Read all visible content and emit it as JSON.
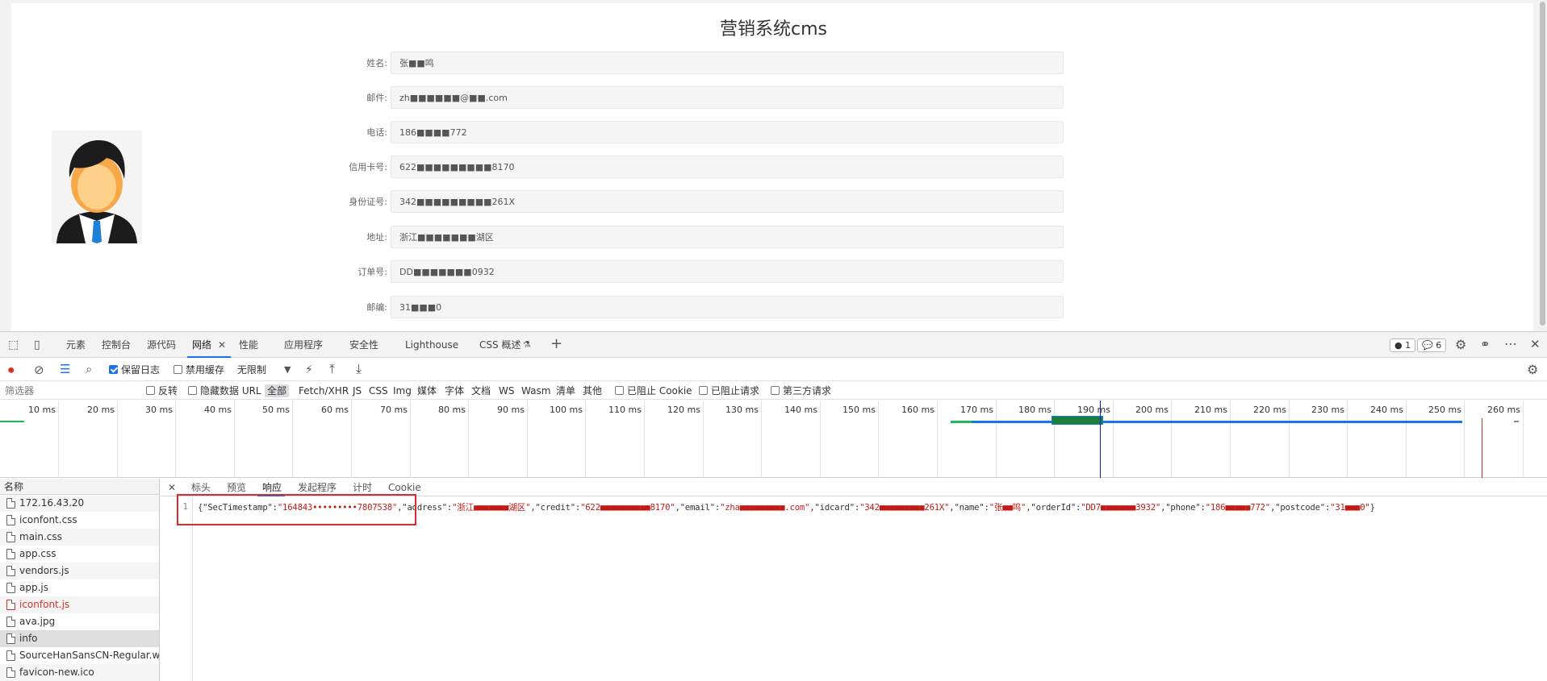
{
  "page": {
    "title": "营销系统cms",
    "fields": [
      {
        "label": "姓名:",
        "value": "张■■鸣"
      },
      {
        "label": "邮件:",
        "value": "zh■■■■■■@■■.com"
      },
      {
        "label": "电话:",
        "value": "186■■■■772"
      },
      {
        "label": "信用卡号:",
        "value": "622■■■■■■■■■8170"
      },
      {
        "label": "身份证号:",
        "value": "342■■■■■■■■■261X"
      },
      {
        "label": "地址:",
        "value": "浙江■■■■■■■湖区"
      },
      {
        "label": "订单号:",
        "value": "DD■■■■■■■0932"
      },
      {
        "label": "邮编:",
        "value": "31■■■0"
      }
    ]
  },
  "devtools": {
    "tabs": [
      "元素",
      "控制台",
      "源代码",
      "网络",
      "性能",
      "应用程序",
      "安全性",
      "Lighthouse",
      "CSS 概述"
    ],
    "issues_count": "1",
    "messages_count": "6",
    "toolbar": {
      "preserve_log": "保留日志",
      "disable_cache": "禁用缓存",
      "throttle": "无限制"
    },
    "filter": {
      "placeholder": "筛选器",
      "invert": "反转",
      "hide_data_urls": "隐藏数据 URL",
      "types": [
        "全部",
        "Fetch/XHR",
        "JS",
        "CSS",
        "Img",
        "媒体",
        "字体",
        "文档",
        "WS",
        "Wasm",
        "清单",
        "其他"
      ],
      "blocked_cookies": "已阻止 Cookie",
      "blocked_requests": "已阻止请求",
      "third_party": "第三方请求"
    },
    "timeline_ticks": [
      "10 ms",
      "20 ms",
      "30 ms",
      "40 ms",
      "50 ms",
      "60 ms",
      "70 ms",
      "80 ms",
      "90 ms",
      "100 ms",
      "110 ms",
      "120 ms",
      "130 ms",
      "140 ms",
      "150 ms",
      "160 ms",
      "170 ms",
      "180 ms",
      "190 ms",
      "200 ms",
      "210 ms",
      "220 ms",
      "230 ms",
      "240 ms",
      "250 ms",
      "260 ms"
    ],
    "list_header": "名称",
    "requests": [
      {
        "name": "172.16.43.20",
        "error": false,
        "selected": false
      },
      {
        "name": "iconfont.css",
        "error": false,
        "selected": false
      },
      {
        "name": "main.css",
        "error": false,
        "selected": false
      },
      {
        "name": "app.css",
        "error": false,
        "selected": false
      },
      {
        "name": "vendors.js",
        "error": false,
        "selected": false
      },
      {
        "name": "app.js",
        "error": false,
        "selected": false
      },
      {
        "name": "iconfont.js",
        "error": true,
        "selected": false
      },
      {
        "name": "ava.jpg",
        "error": false,
        "selected": false
      },
      {
        "name": "info",
        "error": false,
        "selected": true
      },
      {
        "name": "SourceHanSansCN-Regular.w...",
        "error": false,
        "selected": false
      },
      {
        "name": "favicon-new.ico",
        "error": false,
        "selected": false
      }
    ],
    "detail_tabs": [
      "标头",
      "预览",
      "响应",
      "发起程序",
      "计时",
      "Cookie"
    ],
    "response": {
      "line": "1",
      "k_ts": "{\"SecTimestamp\":",
      "v_ts": "\"164843•••••••••7807538\"",
      "k_addr": ",\"address\":",
      "v_addr": "\"浙江■■■■■■■湖区\"",
      "k_credit": ",\"credit\":",
      "v_credit": "\"622■■■■■■■■■■8170\"",
      "k_email": ",\"email\":",
      "v_email": "\"zha■■■■■■■■■.com\"",
      "k_idcard": ",\"idcard\":",
      "v_idcard": "\"342■■■■■■■■■261X\"",
      "k_name": ",\"name\":",
      "v_name": "\"张■■鸣\"",
      "k_order": ",\"orderId\":",
      "v_order": "\"DD7■■■■■■■3932\"",
      "k_phone": ",\"phone\":",
      "v_phone": "\"186■■■■■772\"",
      "k_post": ",\"postcode\":",
      "v_post": "\"31■■■0\"",
      "end": "}"
    }
  }
}
